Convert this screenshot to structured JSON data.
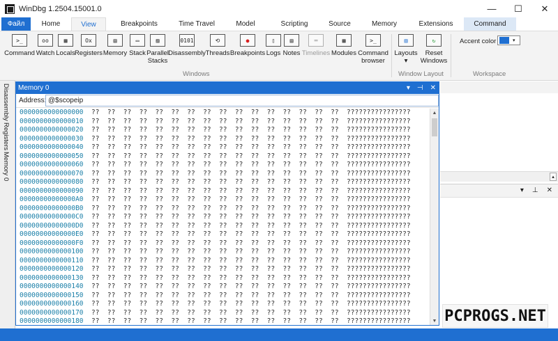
{
  "window": {
    "title": "WinDbg 1.2504.15001.0",
    "controls": {
      "minimize": "—",
      "maximize": "☐",
      "close": "✕"
    }
  },
  "tabs": {
    "file": "Файл",
    "items": [
      "Home",
      "View",
      "Breakpoints",
      "Time Travel",
      "Model",
      "Scripting",
      "Source",
      "Memory",
      "Extensions",
      "Command"
    ],
    "active": "View"
  },
  "ribbon": {
    "windows_buttons": [
      {
        "label": "Command",
        "icon": ">_"
      },
      {
        "label": "Watch",
        "icon": "oo"
      },
      {
        "label": "Locals",
        "icon": "▦"
      },
      {
        "label": "Registers",
        "icon": "Ox"
      },
      {
        "label": "Memory",
        "icon": "▤"
      },
      {
        "label": "Stack",
        "icon": "▭"
      },
      {
        "label": "Parallel Stacks",
        "icon": "▨"
      },
      {
        "label": "Disassembly",
        "icon": "0101"
      },
      {
        "label": "Threads",
        "icon": "⟲"
      },
      {
        "label": "Breakpoints",
        "icon": "●"
      },
      {
        "label": "Logs",
        "icon": "▯"
      },
      {
        "label": "Notes",
        "icon": "▤"
      },
      {
        "label": "Timelines",
        "icon": "═"
      },
      {
        "label": "Modules",
        "icon": "▦"
      },
      {
        "label": "Command browser",
        "icon": ">_"
      }
    ],
    "windows_group_label": "Windows",
    "layout_buttons": [
      {
        "label": "Layouts",
        "icon": "▥",
        "dropdown": "▾"
      },
      {
        "label": "Reset Windows",
        "icon": "↻"
      }
    ],
    "layout_group_label": "Window Layout",
    "workspace": {
      "accent_label": "Accent color",
      "accent_color": "#1f6fd1",
      "dropdown": "▾",
      "group_label": "Workspace"
    }
  },
  "side_tabs": [
    "Disassembly",
    "Registers",
    "Memory 0"
  ],
  "memory_pane": {
    "title": "Memory 0",
    "controls": {
      "menu": "▾",
      "pin": "⊣",
      "close": "✕"
    },
    "address_label": "Address:",
    "address_value": "@$scopeip",
    "bytes_text": "??  ??  ??  ??  ??  ??  ??  ??  ??  ??  ??  ??  ??  ??  ??  ??",
    "ascii_text": "????????????????",
    "rows": [
      "0000000000000000",
      "0000000000000010",
      "0000000000000020",
      "0000000000000030",
      "0000000000000040",
      "0000000000000050",
      "0000000000000060",
      "0000000000000070",
      "0000000000000080",
      "0000000000000090",
      "00000000000000A0",
      "00000000000000B0",
      "00000000000000C0",
      "00000000000000D0",
      "00000000000000E0",
      "00000000000000F0",
      "0000000000000100",
      "0000000000000110",
      "0000000000000120",
      "0000000000000130",
      "0000000000000140",
      "0000000000000150",
      "0000000000000160",
      "0000000000000170",
      "0000000000000180"
    ],
    "scroll": {
      "up": "▲",
      "down": "▼"
    }
  },
  "right_panes": {
    "scroll_arrow": "▴",
    "bottom_controls": {
      "menu": "▾",
      "pin": "⊥",
      "close": "✕"
    }
  },
  "watermark": "PCPROGS.NET",
  "colors": {
    "accent": "#1f6fd1",
    "address": "#1a7fa8"
  }
}
